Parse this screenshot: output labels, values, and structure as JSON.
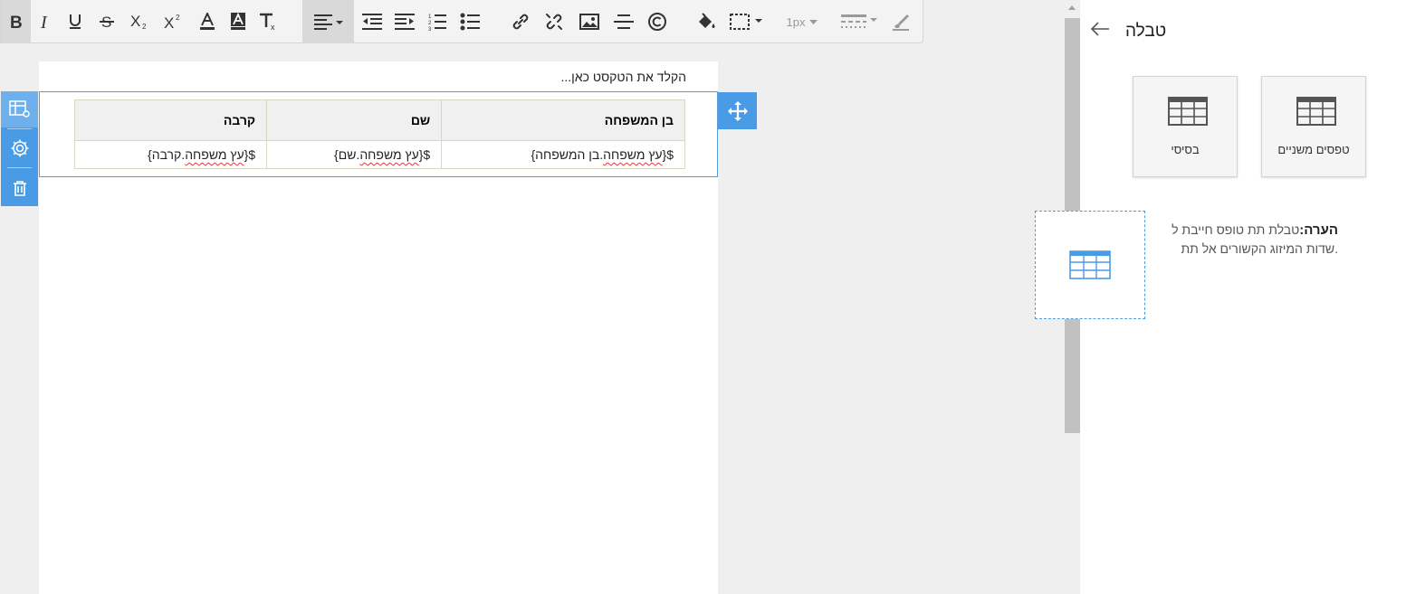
{
  "toolbar": {
    "buttons": [
      "bold",
      "italic",
      "underline",
      "strikethrough",
      "subscript",
      "superscript",
      "font-color",
      "highlight-color",
      "clear-format",
      "align",
      "outdent",
      "indent",
      "ordered-list",
      "bullet-list",
      "link",
      "unlink",
      "image",
      "horizontal-rule",
      "copyright",
      "fill-color",
      "border-style",
      "border-width",
      "border-dash",
      "brush"
    ],
    "border_width_label": "1px"
  },
  "editor": {
    "placeholder": "הקלד את הטקסט כאן...",
    "table": {
      "headers": [
        "בן המשפחה",
        "שם",
        "קרבה"
      ],
      "row": [
        {
          "prefix": "${",
          "field": "עץ משפחה",
          "rest": ".בן המשפחה}"
        },
        {
          "prefix": "${",
          "field": "עץ משפחה",
          "rest": ".שם}"
        },
        {
          "prefix": "${",
          "field": "עץ משפחה",
          "rest": ".קרבה}"
        }
      ]
    }
  },
  "panel": {
    "title": "טבלה",
    "cards": [
      {
        "label": "טפסים משניים",
        "icon": "table-icon"
      },
      {
        "label": "בסיסי",
        "icon": "table-icon"
      }
    ],
    "note_label": "הערה:",
    "note_text": "טבלת תת טופס חייבת ל",
    "note_text2": ".שדות המיזוג הקשורים אל תת"
  },
  "colors": {
    "accent": "#4a9be6",
    "toolbar_bg": "#f3f3f3",
    "canvas_bg": "#efefef"
  }
}
